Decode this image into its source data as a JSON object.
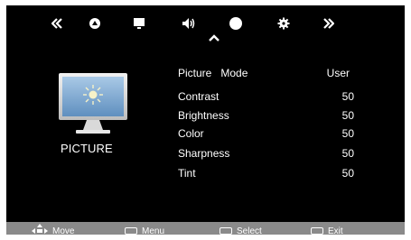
{
  "top_nav": {
    "tabs": [
      {
        "icon": "chevron-double-left-icon"
      },
      {
        "icon": "picture-icon"
      },
      {
        "icon": "monitor-icon"
      },
      {
        "icon": "speaker-icon"
      },
      {
        "icon": "circle-icon"
      },
      {
        "icon": "gear-icon"
      },
      {
        "icon": "chevron-double-right-icon"
      }
    ],
    "active_index": 4
  },
  "section": {
    "label": "PICTURE",
    "icon": "monitor-sun-icon"
  },
  "menu": {
    "items": [
      {
        "label": "Picture   Mode",
        "value": "User"
      },
      {
        "label": "Contrast",
        "value": "50"
      },
      {
        "label": "Brightness",
        "value": "50"
      },
      {
        "label": "Color",
        "value": "50"
      },
      {
        "label": "Sharpness",
        "value": "50"
      },
      {
        "label": "Tint",
        "value": "50"
      }
    ]
  },
  "footer": {
    "move_label": "Move",
    "menu_label": "Menu",
    "select_label": "Select",
    "exit_label": "Exit"
  },
  "colors": {
    "background": "#000000",
    "footer_bar": "#8a8a8a",
    "text": "#ffffff"
  }
}
